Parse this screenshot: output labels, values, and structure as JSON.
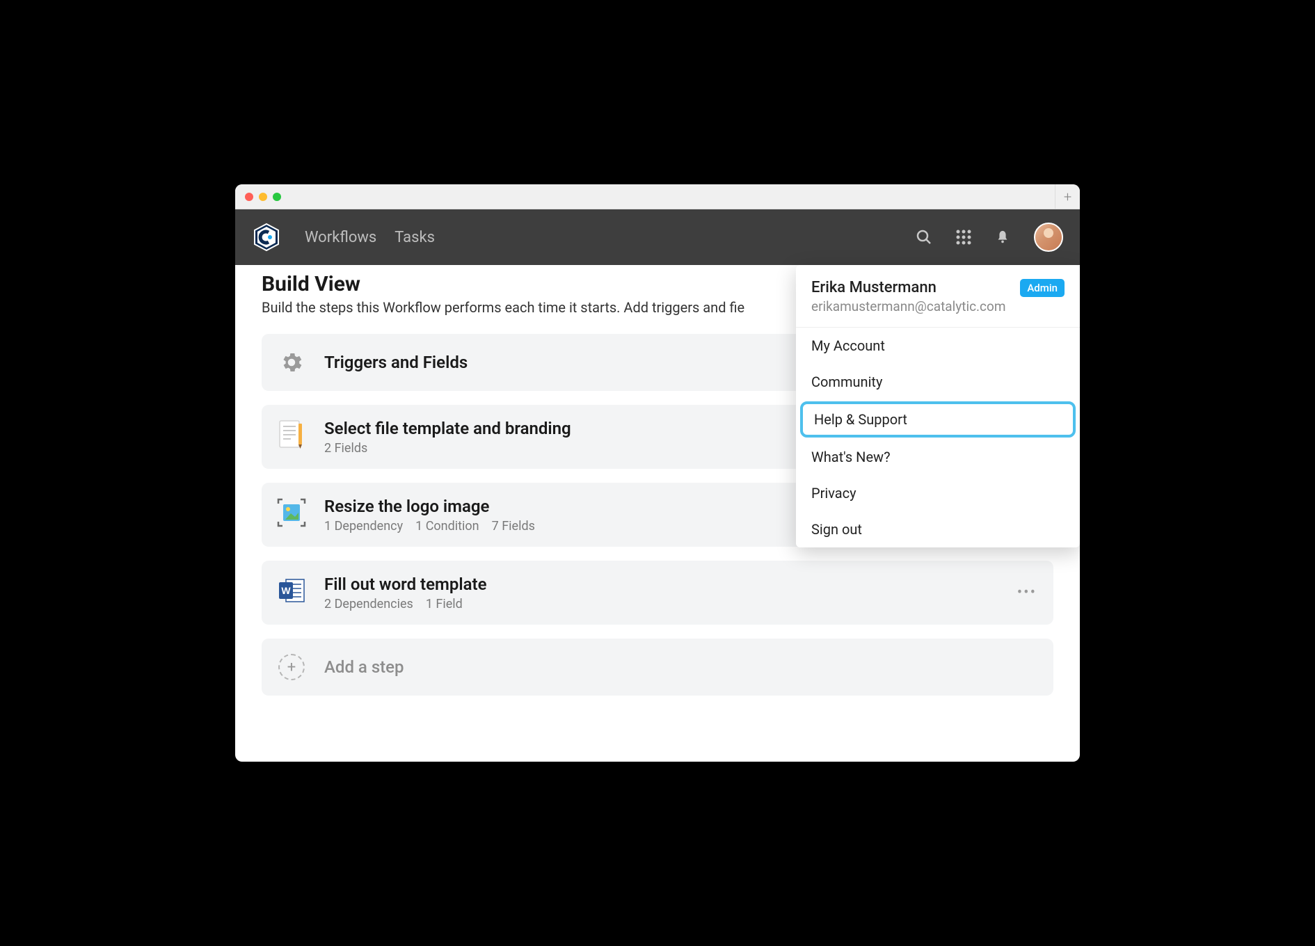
{
  "nav": {
    "link1": "Workflows",
    "link2": "Tasks"
  },
  "page": {
    "title": "Build View",
    "subtitle": "Build the steps this Workflow performs each time it starts. Add triggers and fie"
  },
  "cards": {
    "triggers": {
      "title": "Triggers and Fields"
    },
    "step1": {
      "title": "Select file template and branding",
      "meta1": "2 Fields"
    },
    "step2": {
      "title": "Resize the logo image",
      "meta1": "1 Dependency",
      "meta2": "1 Condition",
      "meta3": "7 Fields"
    },
    "step3": {
      "title": "Fill out word template",
      "meta1": "2 Dependencies",
      "meta2": "1 Field"
    },
    "add": {
      "title": "Add a step"
    }
  },
  "dropdown": {
    "user_name": "Erika Mustermann",
    "user_email": "erikamustermann@catalytic.com",
    "badge": "Admin",
    "item1": "My Account",
    "item2": "Community",
    "item3": "Help & Support",
    "item4": "What's New?",
    "item5": "Privacy",
    "item6": "Sign out"
  }
}
